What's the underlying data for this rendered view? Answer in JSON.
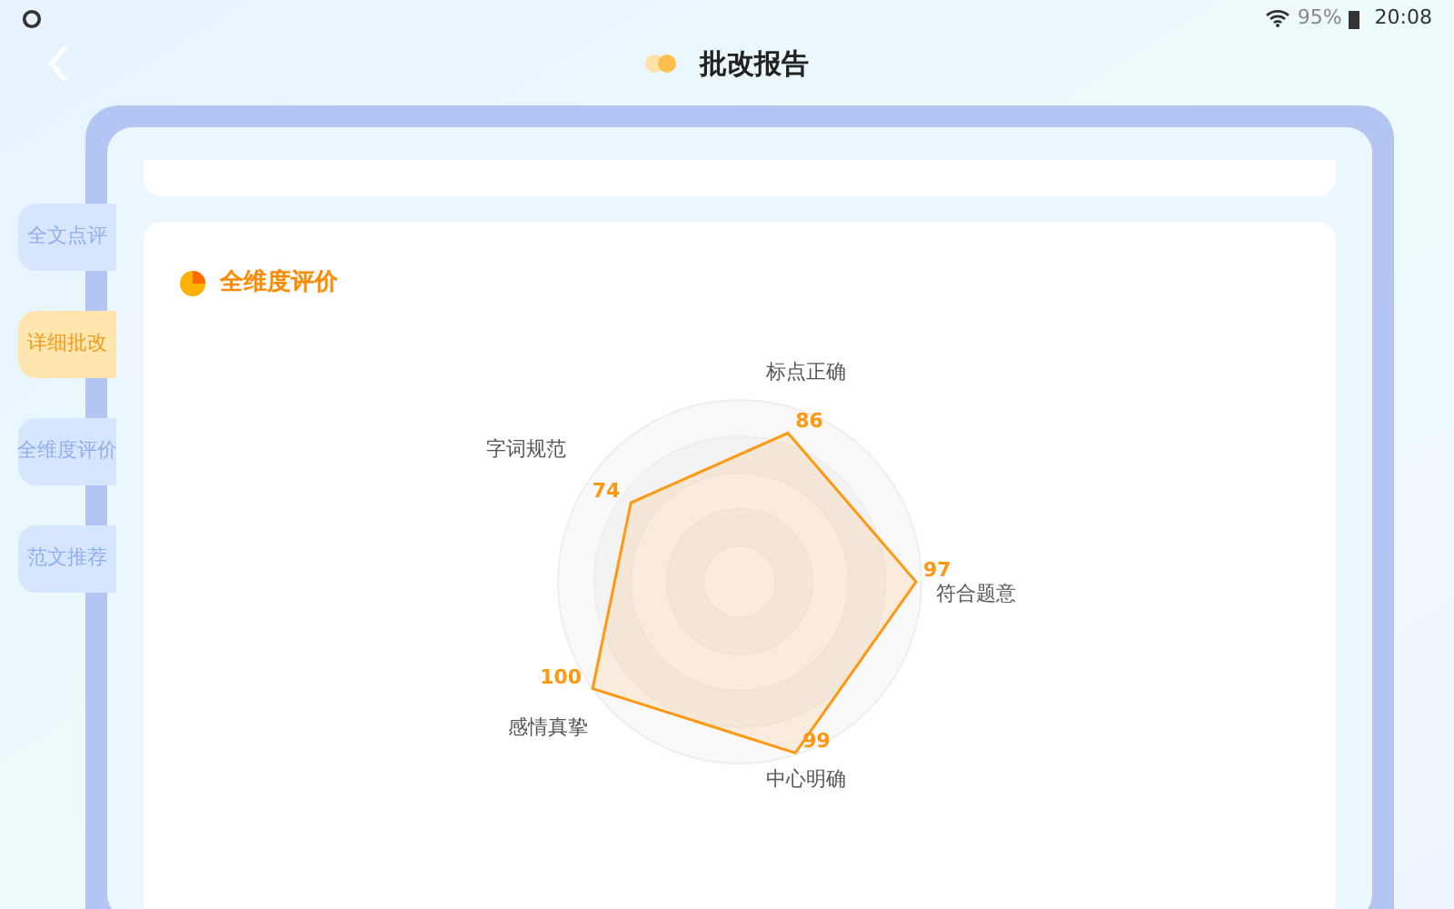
{
  "status_bar": {
    "battery": "95%",
    "time": "20:08"
  },
  "header": {
    "title": "批改报告"
  },
  "side_tabs": [
    {
      "label": "全文点评",
      "selected": false
    },
    {
      "label": "详细批改",
      "selected": true
    },
    {
      "label": "全维度评价",
      "selected": false
    },
    {
      "label": "范文推荐",
      "selected": false
    }
  ],
  "card": {
    "title": "全维度评价",
    "radar_axes": [
      {
        "label": "标点正确",
        "score": "86",
        "kind": "top"
      },
      {
        "label": "字词规范",
        "score": "74",
        "kind": "upperleft"
      },
      {
        "label": "符合题意",
        "score": "97",
        "kind": "right"
      },
      {
        "label": "感情真挚",
        "score": "100",
        "kind": "lowerleft"
      },
      {
        "label": "中心明确",
        "score": "99",
        "kind": "bottom"
      }
    ]
  }
}
